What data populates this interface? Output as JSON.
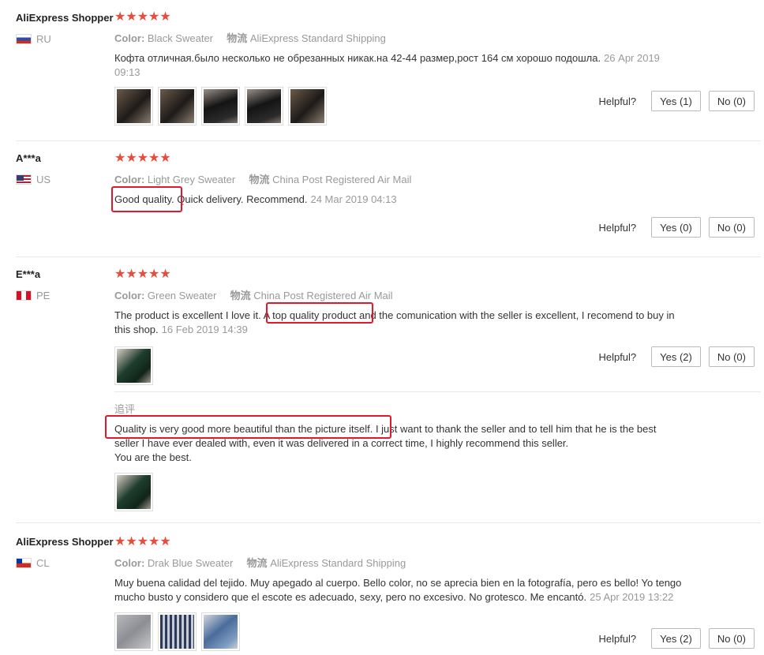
{
  "labels": {
    "color": "Color:",
    "shipping": "物流",
    "helpful": "Helpful?",
    "followup": "追评"
  },
  "reviews": [
    {
      "user": "AliExpress Shopper",
      "country": "RU",
      "stars": "★★★★★",
      "color_value": "Black Sweater",
      "shipping_value": "AliExpress Standard Shipping",
      "text": "Кофта отличная.было несколько не обрезанных никак.на 42-44 размер,рост 164 см хорошо подошла.",
      "date": "26 Apr 2019 09:13",
      "yes": "Yes (1)",
      "no": "No (0)"
    },
    {
      "user": "A***a",
      "country": "US",
      "stars": "★★★★★",
      "color_value": "Light Grey Sweater",
      "shipping_value": "China Post Registered Air Mail",
      "text": "Good quality. Quick delivery. Recommend.",
      "date": "24 Mar 2019 04:13",
      "yes": "Yes (0)",
      "no": "No (0)"
    },
    {
      "user": "E***a",
      "country": "PE",
      "stars": "★★★★★",
      "color_value": "Green Sweater",
      "shipping_value": "China Post Registered Air Mail",
      "text": "The product is excellent I love it. A top quality product and the comunication with the seller is excellent, I recomend to buy in this shop.",
      "date": "16 Feb 2019 14:39",
      "yes": "Yes (2)",
      "no": "No (0)",
      "followup_text_1": "Quality is very good more beautiful than the picture itself. I just want to thank the seller and to tell him that he is the best seller I have ever dealed with, even it was delivered in a correct time, I highly recommend this seller.",
      "followup_text_2": "You are the best."
    },
    {
      "user": "AliExpress Shopper",
      "country": "CL",
      "stars": "★★★★★",
      "color_value": "Drak Blue Sweater",
      "shipping_value": "AliExpress Standard Shipping",
      "text": "Muy buena calidad del tejido. Muy apegado al cuerpo. Bello color, no se aprecia bien en la fotografía, pero es bello! Yo tengo mucho busto y considero que el escote es adecuado, sexy, pero no excesivo. No grotesco. Me encantó.",
      "date": "25 Apr 2019 13:22",
      "yes": "Yes (2)",
      "no": "No (0)"
    }
  ],
  "highlight_color": "#e3172d",
  "star_color": "#e84c3d"
}
